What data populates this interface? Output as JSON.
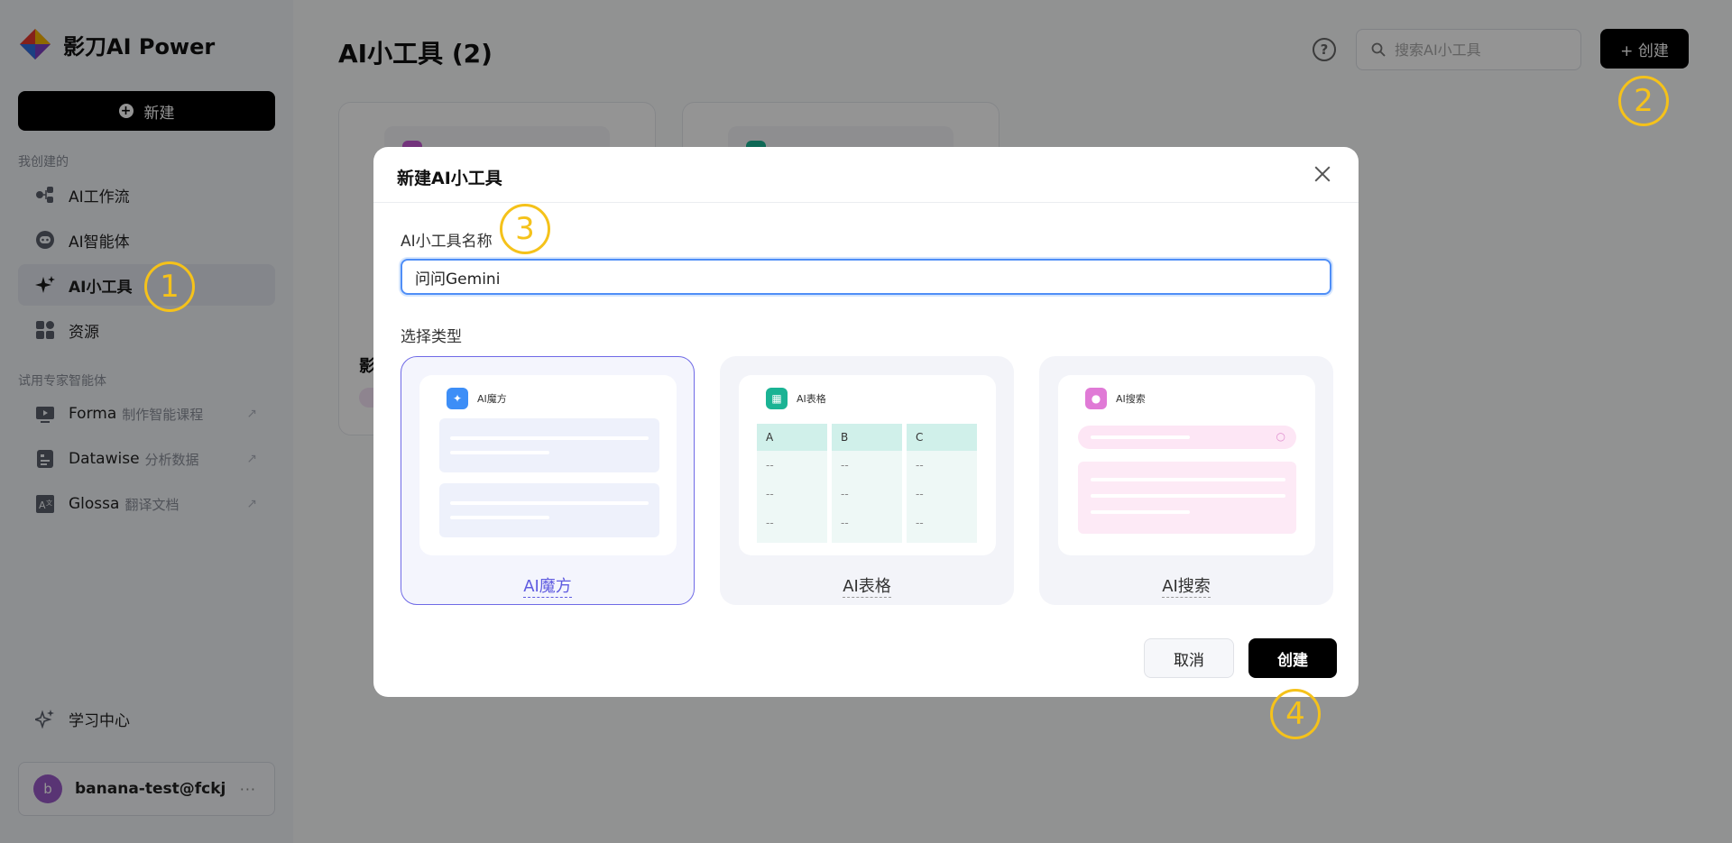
{
  "app": {
    "name": "影刀AI Power"
  },
  "sidebar": {
    "new_label": "新建",
    "section_mine": "我创建的",
    "items": [
      {
        "label": "AI工作流"
      },
      {
        "label": "AI智能体"
      },
      {
        "label": "AI小工具"
      },
      {
        "label": "资源"
      }
    ],
    "section_experts": "试用专家智能体",
    "experts": [
      {
        "label": "Forma",
        "sub": "制作智能课程"
      },
      {
        "label": "Datawise",
        "sub": "分析数据"
      },
      {
        "label": "Glossa",
        "sub": "翻译文档"
      }
    ],
    "learning_center": "学习中心",
    "user": {
      "avatar_letter": "b",
      "name": "banana-test@fckj",
      "more": "···"
    }
  },
  "main": {
    "title": "AI小工具 (2)",
    "search_placeholder": "搜索AI小工具",
    "create_label": "+ 创建",
    "help_glyph": "?",
    "card_title_fragment": "影"
  },
  "modal": {
    "title": "新建AI小工具",
    "name_label": "AI小工具名称",
    "name_value": "问问Gemini",
    "type_label": "选择类型",
    "types": [
      {
        "label": "AI魔方",
        "preview_title": "AI魔方",
        "selected": true
      },
      {
        "label": "AI表格",
        "preview_title": "AI表格",
        "selected": false
      },
      {
        "label": "AI搜索",
        "preview_title": "AI搜索",
        "selected": false
      }
    ],
    "table_preview": {
      "columns": [
        "A",
        "B",
        "C"
      ],
      "cell": "--"
    },
    "cancel_label": "取消",
    "create_label": "创建"
  },
  "steps": {
    "s1": "1",
    "s2": "2",
    "s3": "3",
    "s4": "4"
  },
  "colors": {
    "accent_selected": "#5f5be0",
    "step_marker": "#f5c21a",
    "input_focus": "#4f8ef7",
    "primary_button": "#000000"
  }
}
